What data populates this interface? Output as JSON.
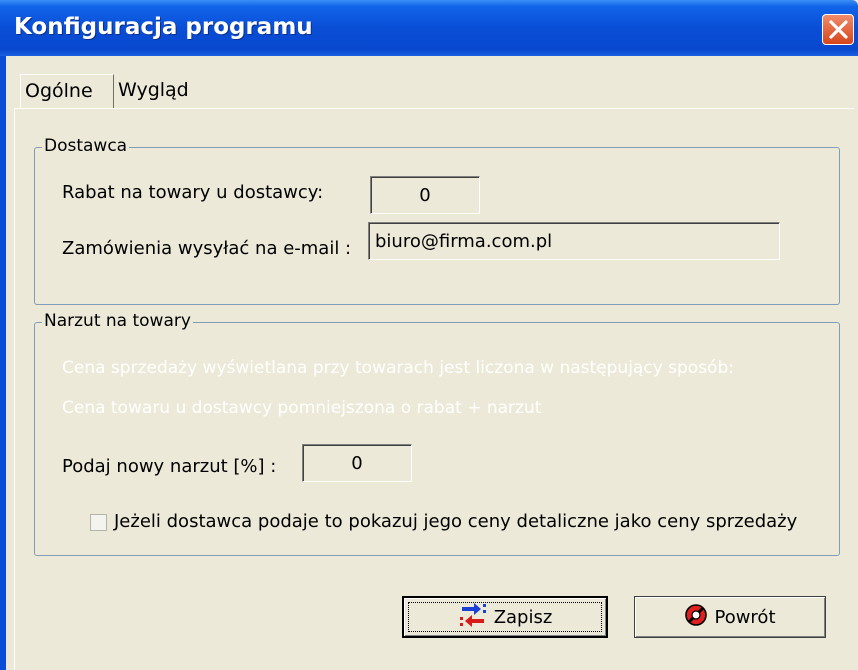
{
  "window": {
    "title": "Konfiguracja programu"
  },
  "tabs": [
    {
      "label": "Ogólne",
      "active": true
    },
    {
      "label": "Wygląd",
      "active": false
    }
  ],
  "supplier_group": {
    "legend": "Dostawca",
    "discount_label": "Rabat na towary u dostawcy:",
    "discount_value": "0",
    "email_label": "Zamówienia wysyłać na e-mail :",
    "email_value": "biuro@firma.com.pl"
  },
  "markup_group": {
    "legend": "Narzut na towary",
    "note_line1": "Cena sprzedaży wyświetlana przy towarach jest liczona w następujący sposób:",
    "note_line2": "Cena towaru u dostawcy pomniejszona o rabat + narzut",
    "markup_label": "Podaj nowy narzut [%] :",
    "markup_value": "0",
    "checkbox_label": "Jeżeli dostawca podaje to pokazuj jego ceny detaliczne jako ceny sprzedaży",
    "checkbox_checked": false
  },
  "buttons": {
    "save_label": "Zapisz",
    "back_label": "Powrót"
  },
  "icons": {
    "close": "close-icon",
    "save": "transfer-arrows-icon",
    "back": "no-entry-icon"
  },
  "colors": {
    "titlebar": "#0a4ed6",
    "close_button": "#d6461b",
    "background": "#ece9d8",
    "group_border": "#7f9db9"
  }
}
